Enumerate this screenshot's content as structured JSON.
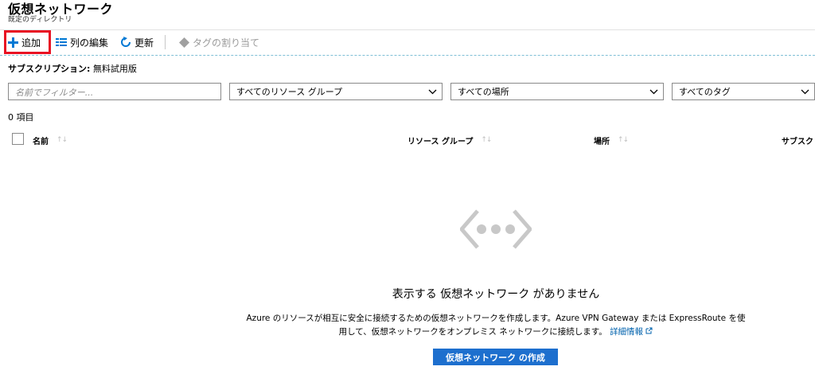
{
  "page": {
    "title": "仮想ネットワーク",
    "subtitle": "既定のディレクトリ"
  },
  "toolbar": {
    "add_label": "追加",
    "edit_columns_label": "列の編集",
    "refresh_label": "更新",
    "assign_tags_label": "タグの割り当て"
  },
  "subscription": {
    "label": "サブスクリプション:",
    "value": "無料試用版"
  },
  "filters": {
    "name_placeholder": "名前でフィルター...",
    "resource_group": "すべてのリソース グループ",
    "location": "すべての場所",
    "tags": "すべてのタグ"
  },
  "item_count": "0 項目",
  "columns": {
    "name": "名前",
    "resource_group": "リソース グループ",
    "location": "場所",
    "subscription": "サブスクリ"
  },
  "empty_state": {
    "title": "表示する 仮想ネットワーク がありません",
    "desc_line1": "Azure のリソースが相互に安全に接続するための仮想ネットワークを作成します。Azure VPN Gateway または ExpressRoute を使",
    "desc_line2": "用して、仮想ネットワークをオンプレミス ネットワークに接続します。",
    "learn_more": "詳細情報",
    "create_button": "仮想ネットワーク の作成"
  },
  "colors": {
    "accent": "#0078d4",
    "highlight": "#e81123",
    "button": "#1d6fce"
  }
}
